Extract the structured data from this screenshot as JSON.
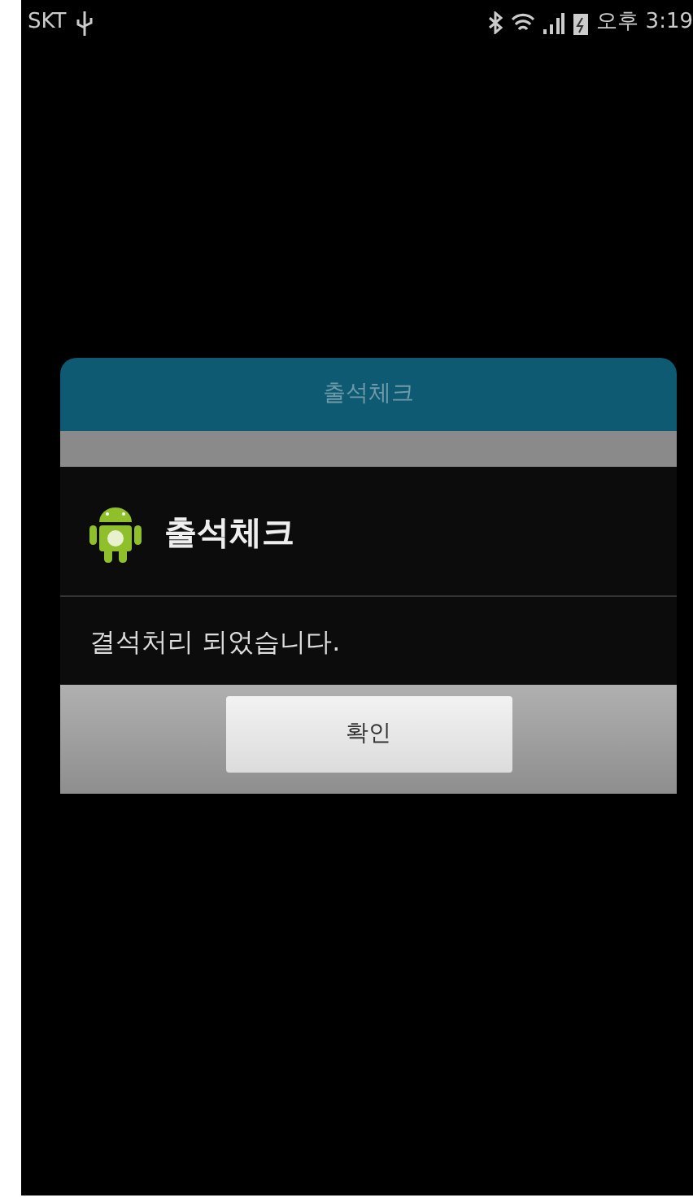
{
  "status_bar": {
    "carrier": "SKT",
    "time": "오후 3:19"
  },
  "background_dialog": {
    "title": "출석체크"
  },
  "alert_dialog": {
    "title": "출석체크",
    "message": "결석처리 되었습니다.",
    "buttons": [
      "확인"
    ]
  }
}
